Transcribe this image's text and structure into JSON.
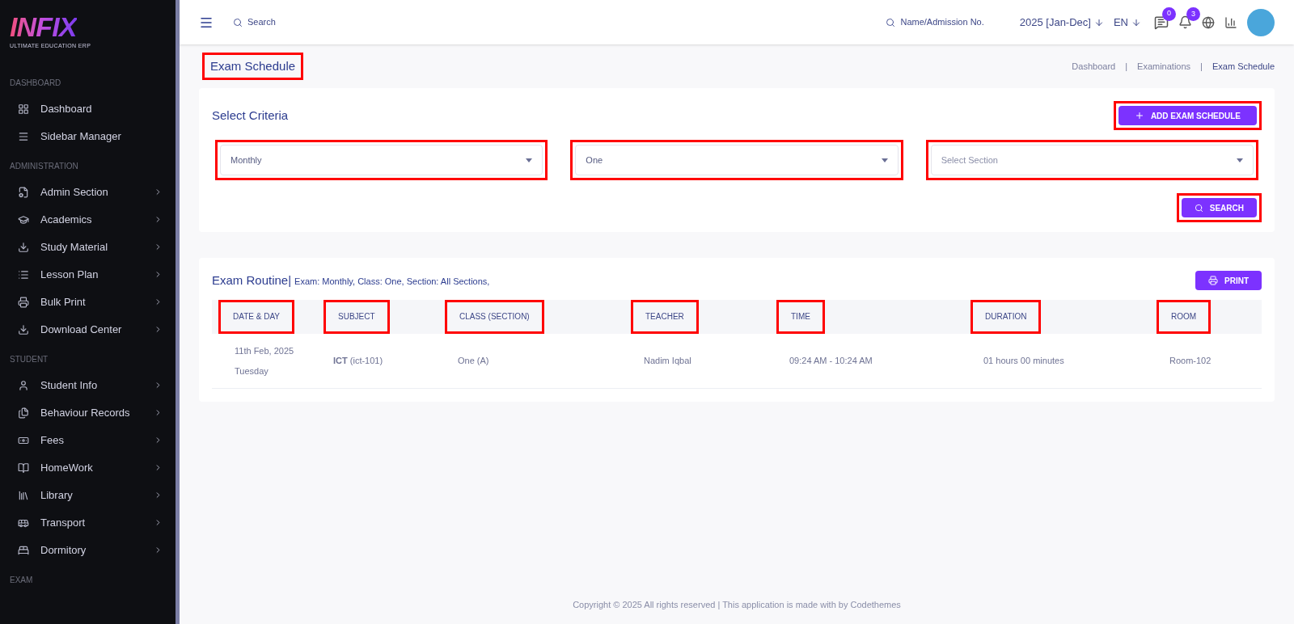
{
  "logo": {
    "name": "INFIX",
    "tagline": "ULTIMATE EDUCATION ERP"
  },
  "sidebar": {
    "sections": [
      {
        "title": "DASHBOARD",
        "items": [
          {
            "label": "Dashboard",
            "expandable": false
          },
          {
            "label": "Sidebar Manager",
            "expandable": false
          }
        ]
      },
      {
        "title": "ADMINISTRATION",
        "items": [
          {
            "label": "Admin Section",
            "expandable": true
          },
          {
            "label": "Academics",
            "expandable": true
          },
          {
            "label": "Study Material",
            "expandable": true
          },
          {
            "label": "Lesson Plan",
            "expandable": true
          },
          {
            "label": "Bulk Print",
            "expandable": true
          },
          {
            "label": "Download Center",
            "expandable": true
          }
        ]
      },
      {
        "title": "STUDENT",
        "items": [
          {
            "label": "Student Info",
            "expandable": true
          },
          {
            "label": "Behaviour Records",
            "expandable": true
          },
          {
            "label": "Fees",
            "expandable": true
          },
          {
            "label": "HomeWork",
            "expandable": true
          },
          {
            "label": "Library",
            "expandable": true
          },
          {
            "label": "Transport",
            "expandable": true
          },
          {
            "label": "Dormitory",
            "expandable": true
          }
        ]
      },
      {
        "title": "EXAM"
      }
    ]
  },
  "topbar": {
    "search": "Search",
    "student_search": "Name/Admission No.",
    "session": "2025 [Jan-Dec]",
    "language": "EN",
    "messages_badge": "0",
    "notifications_badge": "3"
  },
  "page": {
    "title": "Exam Schedule",
    "title_highlighted": true,
    "breadcrumbs": [
      "Dashboard",
      "Examinations",
      "Exam Schedule"
    ],
    "breadcrumb_separator": "|"
  },
  "criteria": {
    "title": "Select Criteria",
    "add_button": {
      "label": "ADD EXAM SCHEDULE",
      "highlighted": true
    },
    "selects": [
      {
        "value": "Monthly",
        "highlighted": true
      },
      {
        "value": "One",
        "highlighted": true
      },
      {
        "placeholder": "Select Section",
        "highlighted": true
      }
    ],
    "search_button": {
      "label": "SEARCH",
      "highlighted": true
    }
  },
  "routine": {
    "title": "Exam Routine|",
    "subtitle": "Exam: Monthly, Class: One, Section: All Sections,",
    "print_button": {
      "label": "PRINT",
      "highlighted": false
    },
    "columns": [
      {
        "label": "DATE & DAY",
        "highlighted": true
      },
      {
        "label": "SUBJECT",
        "highlighted": true
      },
      {
        "label": "CLASS (SECTION)",
        "highlighted": true
      },
      {
        "label": "TEACHER",
        "highlighted": true
      },
      {
        "label": "TIME",
        "highlighted": true
      },
      {
        "label": "DURATION",
        "highlighted": true
      },
      {
        "label": "ROOM",
        "highlighted": true
      }
    ],
    "rows": [
      {
        "date": "11th Feb, 2025",
        "day": "Tuesday",
        "subject": "**ICT** (ict-101)",
        "class": "One (A)",
        "teacher": "Nadim Iqbal",
        "time": "09:24 AM - 10:24 AM",
        "duration": "01 hours 00 minutes",
        "room": "Room-102"
      }
    ]
  },
  "footer": "Copyright © 2025 All rights reserved | This application is made with by Codethemes"
}
